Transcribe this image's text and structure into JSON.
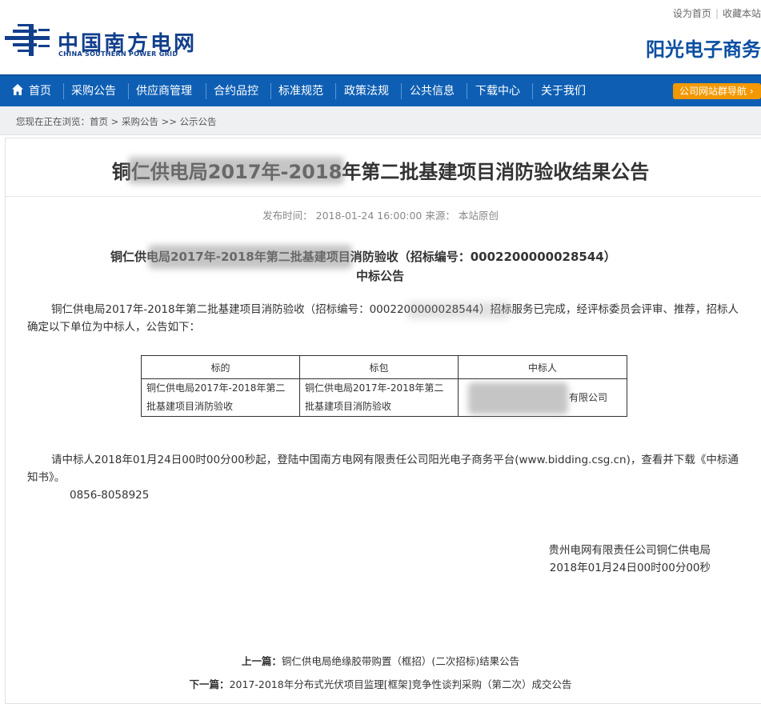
{
  "header": {
    "links": [
      "设为首页",
      "收藏本站"
    ],
    "logo_cn": "中国南方电网",
    "logo_en": "CHINA SOUTHERN POWER GRID",
    "platform": "阳光电子商务"
  },
  "nav": {
    "items": [
      "首页",
      "采购公告",
      "供应商管理",
      "合约品控",
      "标准规范",
      "政策法规",
      "公共信息",
      "下载中心",
      "关于我们"
    ],
    "guide": "公司网站群导航"
  },
  "breadcrumb": "您现在正在浏览：首页 > 采购公告 >> 公示公告",
  "article": {
    "title": "铜仁供电局2017年-2018年第二批基建项目消防验收结果公告",
    "meta": "发布时间： 2018-01-24 16:00:00  来源： 本站原创",
    "subhead": "铜仁供电局2017年-2018年第二批基建项目消防验收（招标编号：0002200000028544）",
    "subhead2": "中标公告",
    "para1": "铜仁供电局2017年-2018年第二批基建项目消防验收（招标编号：0002200000028544）招标服务已完成，经评标委员会评审、推荐，招标人确定以下单位为中标人，公告如下：",
    "table": {
      "headers": [
        "标的",
        "标包",
        "中标人"
      ],
      "rows": [
        [
          "铜仁供电局2017年-2018年第二批基建项目消防验收",
          "铜仁供电局2017年-2018年第二批基建项目消防验收",
          "有限公司"
        ]
      ]
    },
    "para2": "请中标人2018年01月24日00时00分00秒起，登陆中国南方电网有限责任公司阳光电子商务平台(www.bidding.csg.cn)，查看并下载《中标通知书》。",
    "phone": "0856-8058925",
    "sign_org": "贵州电网有限责任公司铜仁供电局",
    "sign_date": "2018年01月24日00时00分00秒"
  },
  "pager": {
    "prev_label": "上一篇：",
    "prev_title": "铜仁供电局绝缘胶带购置（框招）(二次招标)结果公告",
    "next_label": "下一篇：",
    "next_title": "2017-2018年分布式光伏项目监理[框架]竞争性谈判采购（第二次）成交公告"
  },
  "colors": {
    "nav": "#0e5fb4",
    "brand": "#123f8c",
    "guide": "#f39800"
  }
}
